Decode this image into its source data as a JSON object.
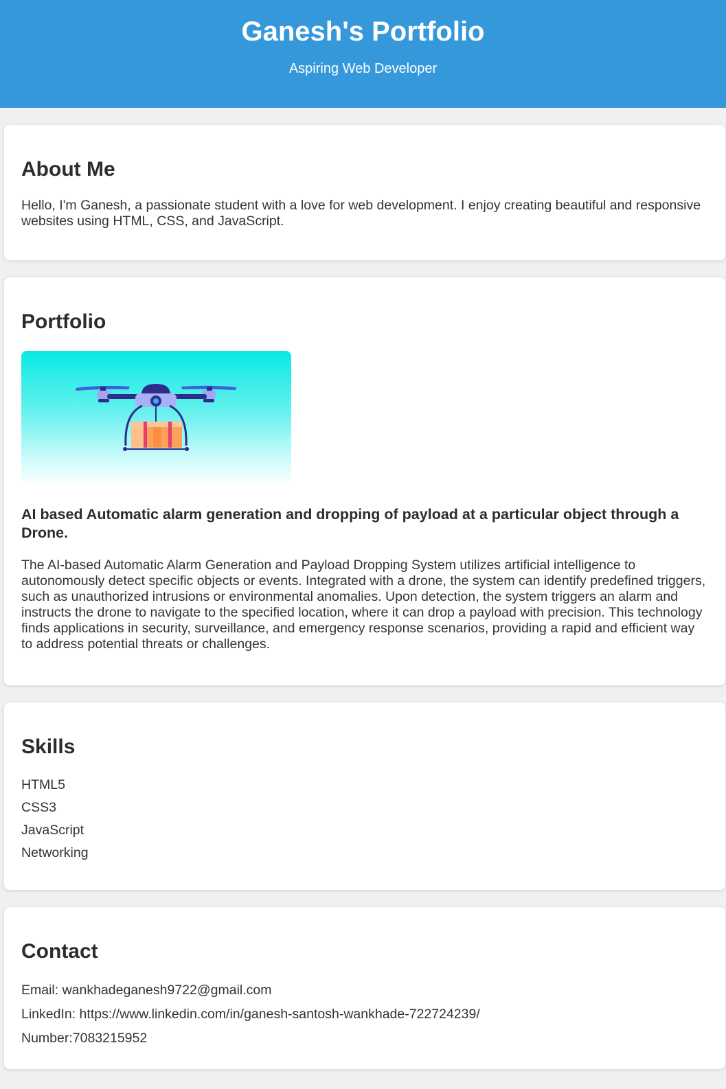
{
  "header": {
    "title": "Ganesh's Portfolio",
    "subtitle": "Aspiring Web Developer",
    "background_color": "#3498db"
  },
  "about": {
    "heading": "About Me",
    "text": "Hello, I'm Ganesh, a passionate student with a love for web development. I enjoy creating beautiful and responsive websites using HTML, CSS, and JavaScript."
  },
  "portfolio": {
    "heading": "Portfolio",
    "project": {
      "image_icon": "delivery-drone-icon",
      "title": "AI based Automatic alarm generation and dropping of payload at a particular object through a Drone.",
      "description": "The AI-based Automatic Alarm Generation and Payload Dropping System utilizes artificial intelligence to autonomously detect specific objects or events. Integrated with a drone, the system can identify predefined triggers, such as unauthorized intrusions or environmental anomalies. Upon detection, the system triggers an alarm and instructs the drone to navigate to the specified location, where it can drop a payload with precision. This technology finds applications in security, surveillance, and emergency response scenarios, providing a rapid and efficient way to address potential threats or challenges."
    }
  },
  "skills": {
    "heading": "Skills",
    "items": [
      "HTML5",
      "CSS3",
      "JavaScript",
      "Networking"
    ]
  },
  "contact": {
    "heading": "Contact",
    "email": "Email: wankhadeganesh9722@gmail.com",
    "linkedin": "LinkedIn: https://www.linkedin.com/in/ganesh-santosh-wankhade-722724239/",
    "number": "Number:7083215952"
  }
}
